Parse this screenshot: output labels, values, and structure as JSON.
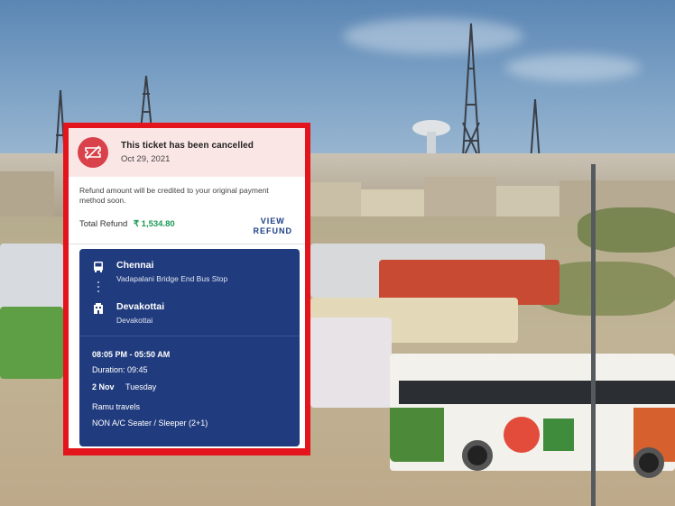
{
  "ticket": {
    "status_title": "This ticket has been cancelled",
    "cancel_date": "Oct 29, 2021",
    "refund_message": "Refund amount will be credited to your original payment method soon.",
    "total_refund_label": "Total Refund",
    "total_refund_amount": "₹ 1,534.80",
    "view_refund_line1": "VIEW",
    "view_refund_line2": "REFUND",
    "origin": {
      "city": "Chennai",
      "point": "Vadapalani Bridge End Bus Stop"
    },
    "destination": {
      "city": "Devakottai",
      "point": "Devakottai"
    },
    "time_range": "08:05 PM - 05:50 AM",
    "duration": "Duration: 09:45",
    "date": "2 Nov",
    "weekday": "Tuesday",
    "operator": "Ramu  travels",
    "bus_type": "NON A/C Seater / Sleeper (2+1)"
  },
  "colors": {
    "frame": "#e3141b",
    "banner_bg": "#fbe6e6",
    "cancel_icon": "#d9424a",
    "refund_green": "#1c9a54",
    "link_blue": "#1d3f86",
    "trip_card": "#213c7e"
  },
  "icons": {
    "cancel": "ticket-cancelled-icon",
    "origin": "bus-stop-icon",
    "destination": "building-icon"
  }
}
